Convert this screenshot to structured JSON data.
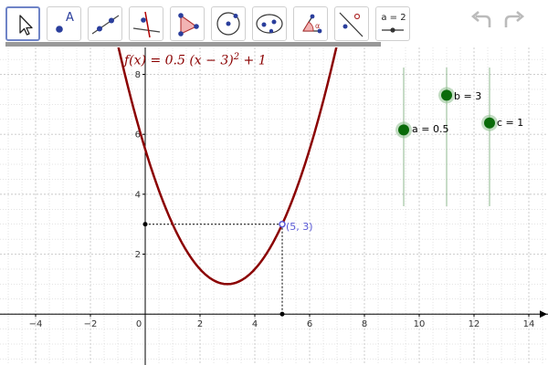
{
  "toolbar": {
    "tools": [
      {
        "name": "move",
        "icon": "pointer-icon",
        "selected": true
      },
      {
        "name": "point",
        "icon": "point-icon",
        "caption": "A"
      },
      {
        "name": "line",
        "icon": "line-through-points-icon"
      },
      {
        "name": "perpendicular",
        "icon": "perpendicular-line-icon"
      },
      {
        "name": "polygon",
        "icon": "polygon-icon"
      },
      {
        "name": "circle",
        "icon": "circle-center-point-icon"
      },
      {
        "name": "ellipse",
        "icon": "ellipse-icon"
      },
      {
        "name": "angle",
        "icon": "angle-icon"
      },
      {
        "name": "reflect",
        "icon": "reflect-about-line-icon"
      },
      {
        "name": "slider",
        "icon": "slider-icon",
        "caption": "a = 2"
      }
    ],
    "undo_icon": "undo-icon",
    "redo_icon": "redo-icon"
  },
  "graph": {
    "function_label_parts": [
      "f(x) = 0.5 (x − 3)",
      "2",
      " + 1"
    ],
    "a": 0.5,
    "b": 3,
    "c": 1,
    "function_color": "#8b0000",
    "point": {
      "x": 5,
      "y": 3,
      "label": "(5, 3)"
    },
    "point_color": "#5a5ad6",
    "x_ticks": [
      "−4",
      "−2",
      "0",
      "2",
      "4",
      "6",
      "8",
      "10",
      "12",
      "14"
    ],
    "y_ticks": [
      "2",
      "4",
      "6",
      "8"
    ],
    "x_range": [
      -5.3,
      14.7
    ],
    "y_range": [
      -1.7,
      8.9
    ],
    "sliders": [
      {
        "name": "a",
        "label": "a = 0.5",
        "value": 0.5,
        "min": -5,
        "max": 5
      },
      {
        "name": "b",
        "label": "b = 3",
        "value": 3,
        "min": -5,
        "max": 5
      },
      {
        "name": "c",
        "label": "c = 1",
        "value": 1,
        "min": -5,
        "max": 5
      }
    ],
    "slider_color": "#0a6b0a",
    "grid_color": "#c8c8c8"
  }
}
